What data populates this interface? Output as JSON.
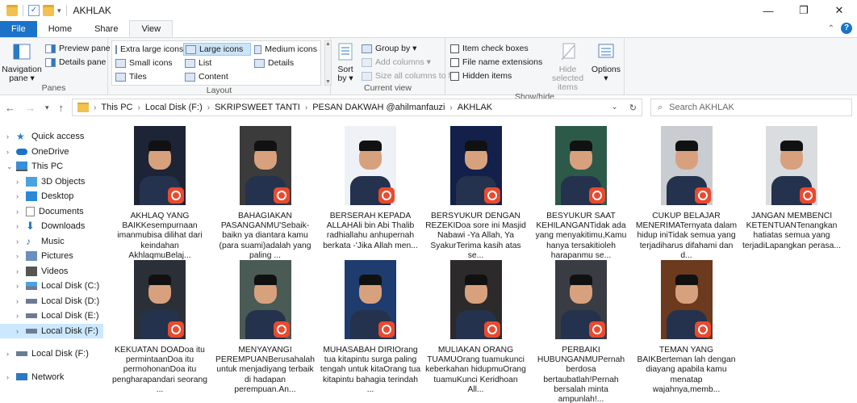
{
  "window": {
    "title": "AKHLAK",
    "minimize": "—",
    "maximize": "❐",
    "close": "✕"
  },
  "tabs": [
    {
      "label": "File"
    },
    {
      "label": "Home"
    },
    {
      "label": "Share"
    },
    {
      "label": "View"
    }
  ],
  "help": {
    "collapse": "⌃",
    "q": "?"
  },
  "ribbon": {
    "panes": {
      "navigation_pane": "Navigation pane ▾",
      "preview_pane": "Preview pane",
      "details_pane": "Details pane",
      "group_label": "Panes"
    },
    "layout": {
      "options": [
        {
          "label": "Extra large icons",
          "selected": false
        },
        {
          "label": "Large icons",
          "selected": true
        },
        {
          "label": "Medium icons",
          "selected": false
        },
        {
          "label": "Small icons",
          "selected": false
        },
        {
          "label": "List",
          "selected": false
        },
        {
          "label": "Details",
          "selected": false
        },
        {
          "label": "Tiles",
          "selected": false
        },
        {
          "label": "Content",
          "selected": false
        }
      ],
      "group_label": "Layout"
    },
    "current_view": {
      "sort_by": "Sort by ▾",
      "group_by": "Group by ▾",
      "add_columns": "Add columns ▾",
      "size_all_columns": "Size all columns to fit",
      "group_label": "Current view"
    },
    "show_hide": {
      "item_check_boxes": "Item check boxes",
      "file_name_extensions": "File name extensions",
      "hidden_items": "Hidden items",
      "hide_selected_items": "Hide selected items",
      "options": "Options ▾",
      "group_label": "Show/hide"
    }
  },
  "address_bar": {
    "crumbs": [
      "This PC",
      "Local Disk (F:)",
      "SKRIPSWEET TANTI",
      "PESAN DAKWAH @ahilmanfauzi",
      "AKHLAK"
    ],
    "search_placeholder": "Search AKHLAK"
  },
  "sidebar": {
    "items": [
      {
        "label": "Quick access",
        "icon": "star-icon",
        "color": "#2a7fd4"
      },
      {
        "label": "OneDrive",
        "icon": "cloud-icon",
        "color": "#1a73c8"
      },
      {
        "label": "This PC",
        "icon": "pc-icon",
        "color": "#3a8ed6"
      },
      {
        "label": "3D Objects",
        "icon": "cube-icon",
        "color": "#4aa3df"
      },
      {
        "label": "Desktop",
        "icon": "desktop-icon",
        "color": "#2b88d8"
      },
      {
        "label": "Documents",
        "icon": "document-icon",
        "color": "#8a8a8a"
      },
      {
        "label": "Downloads",
        "icon": "download-icon",
        "color": "#2b79c2"
      },
      {
        "label": "Music",
        "icon": "music-icon",
        "color": "#2b79c2"
      },
      {
        "label": "Pictures",
        "icon": "pictures-icon",
        "color": "#6a8fbf"
      },
      {
        "label": "Videos",
        "icon": "video-icon",
        "color": "#555555"
      },
      {
        "label": "Local Disk (C:)",
        "icon": "drive-windows-icon",
        "color": "#6b7c93"
      },
      {
        "label": "Local Disk (D:)",
        "icon": "drive-icon",
        "color": "#6b7c93"
      },
      {
        "label": "Local Disk (E:)",
        "icon": "drive-icon",
        "color": "#6b7c93"
      },
      {
        "label": "Local Disk (F:)",
        "icon": "drive-icon",
        "color": "#6b7c93"
      },
      {
        "label": "Local Disk (F:)",
        "icon": "drive-icon",
        "color": "#6b7c93"
      },
      {
        "label": "Network",
        "icon": "network-icon",
        "color": "#2b79c2"
      }
    ]
  },
  "files": [
    {
      "name": "AKHLAQ YANG BAIKKesempurnaan imanmubisa dilihat dari keindahan AkhlaqmuBelaj...",
      "bg": "#1d2436"
    },
    {
      "name": "BAHAGIAKAN PASANGANMU'Sebaik-baikn ya diantara kamu (para suami)adalah yang paling ...",
      "bg": "#3b3b3b"
    },
    {
      "name": "BERSERAH KEPADA ALLAHAli bin Abi Thalib radhiallahu anhupernah berkata -'Jika Allah men...",
      "bg": "#eef1f6"
    },
    {
      "name": "BERSYUKUR DENGAN REZEKIDoa sore ini Masjid Nabawi -Ya Allah, Ya SyakurTerima kasih atas se...",
      "bg": "#12204a"
    },
    {
      "name": "BESYUKUR SAAT KEHILANGANTidak ada yang menyakitimu,Kamu hanya tersakitioleh harapanmu se...",
      "bg": "#2d5a48"
    },
    {
      "name": "CUKUP BELAJAR MENERIMATernyata dalam hidup iniTidak semua yang terjadiharus difahami dan d...",
      "bg": "#c9cdd1"
    },
    {
      "name": "JANGAN MEMBENCI KETENTUANTenangkan hatiatas semua yang terjadiLapangkan perasa...",
      "bg": "#d9dde0"
    },
    {
      "name": "KEKUATAN DOADoa itu permintaanDoa itu permohonanDoa itu pengharapandari seorang ...",
      "bg": "#2b2f38"
    },
    {
      "name": "MENYAYANGI PEREMPUANBerusahalah untuk menjadiyang terbaik di hadapan perempuan.An...",
      "bg": "#4a5a55"
    },
    {
      "name": "MUHASABAH DIRIOrang tua kitapintu surga paling tengah untuk kitaOrang tua kitapintu bahagia terindah ...",
      "bg": "#1f3c6e"
    },
    {
      "name": "MULIAKAN ORANG TUAMUOrang tuamukunci keberkahan hidupmuOrang tuamuKunci Keridhoan All...",
      "bg": "#2c2a2a"
    },
    {
      "name": "PERBAIKI HUBUNGANMUPernah berdosa bertaubatlah!Pernah bersalah minta ampunlah!...",
      "bg": "#3a3c44"
    },
    {
      "name": "TEMAN YANG BAIKBerteman lah dengan diayang apabila kamu menatap wajahnya,memb...",
      "bg": "#6b3a1f"
    }
  ]
}
